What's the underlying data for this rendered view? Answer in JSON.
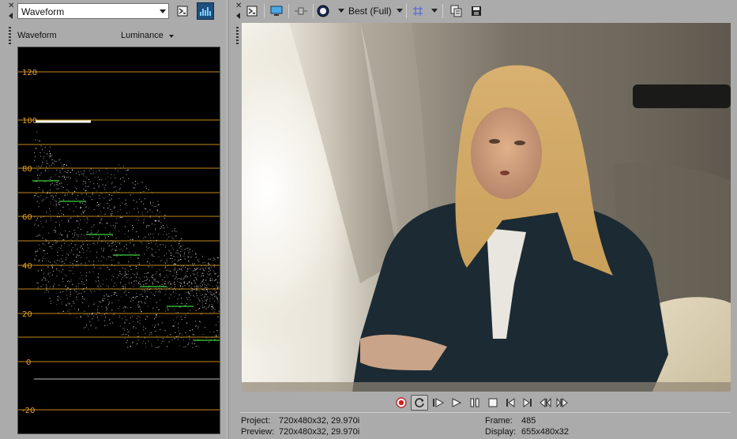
{
  "scopes": {
    "scope_type": "Waveform",
    "panel_title": "Waveform",
    "mode": "Luminance",
    "scale_labels": [
      "120",
      "100",
      "80",
      "60",
      "40",
      "20",
      "0",
      "-20"
    ],
    "graticule_color": "#e8a020",
    "trace_color": "#ffffff",
    "zebra_color": "#3cd23c"
  },
  "preview": {
    "quality": "Best (Full)",
    "transport": [
      "record-icon",
      "loop-icon",
      "play-from-start-icon",
      "play-icon",
      "pause-icon",
      "stop-icon",
      "prev-frame-icon",
      "next-frame-icon",
      "prev-marker-icon",
      "next-marker-icon"
    ],
    "status": {
      "project_label": "Project:",
      "project_value": "720x480x32, 29.970i",
      "preview_label": "Preview:",
      "preview_value": "720x480x32, 29.970i",
      "frame_label": "Frame:",
      "frame_value": "485",
      "display_label": "Display:",
      "display_value": "655x480x32"
    }
  }
}
